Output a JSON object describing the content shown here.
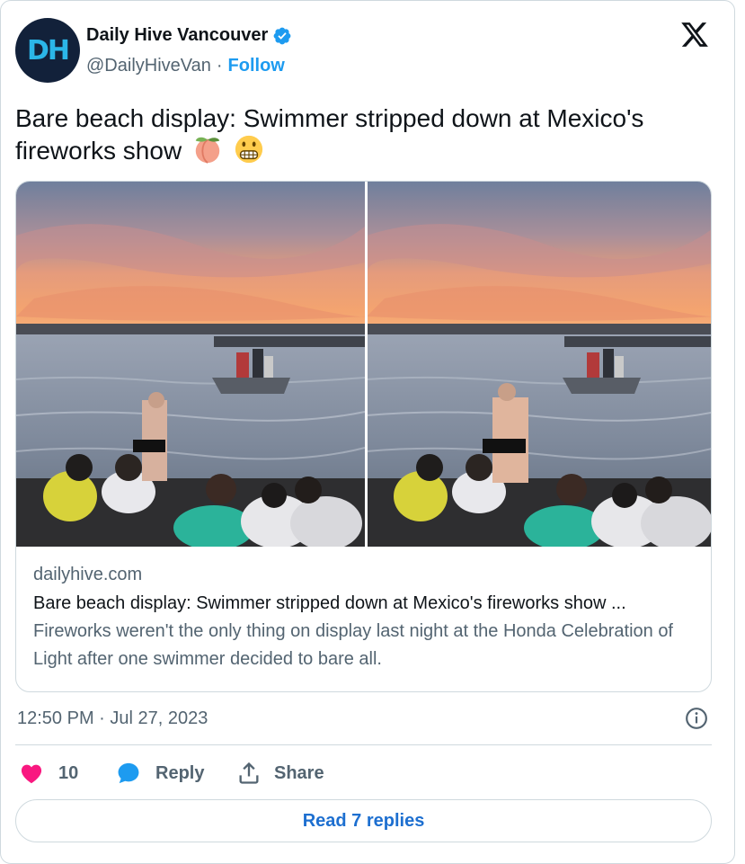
{
  "author": {
    "avatar_text": "DH",
    "display_name": "Daily Hive Vancouver",
    "handle": "@DailyHiveVan",
    "separator": "·",
    "follow_label": "Follow",
    "verified_icon": "verified-badge-icon"
  },
  "tweet": {
    "text": "Bare beach display: Swimmer stripped down at Mexico's fireworks show",
    "emojis": [
      "peach-emoji",
      "grimacing-face-emoji"
    ]
  },
  "link_card": {
    "domain": "dailyhive.com",
    "title": "Bare beach display: Swimmer stripped down at Mexico's fireworks show ...",
    "description": "Fireworks weren't the only thing on display last night at the Honda Celebration of Light after one swimmer decided to bare all."
  },
  "meta": {
    "timestamp": "12:50 PM · Jul 27, 2023"
  },
  "actions": {
    "like_count": "10",
    "reply_label": "Reply",
    "share_label": "Share",
    "read_replies_label": "Read 7 replies"
  },
  "colors": {
    "brand_blue": "#1d9bf0",
    "like_pink": "#f91880",
    "text_primary": "#0f1419",
    "text_secondary": "#536471",
    "border": "#cfd9de"
  }
}
